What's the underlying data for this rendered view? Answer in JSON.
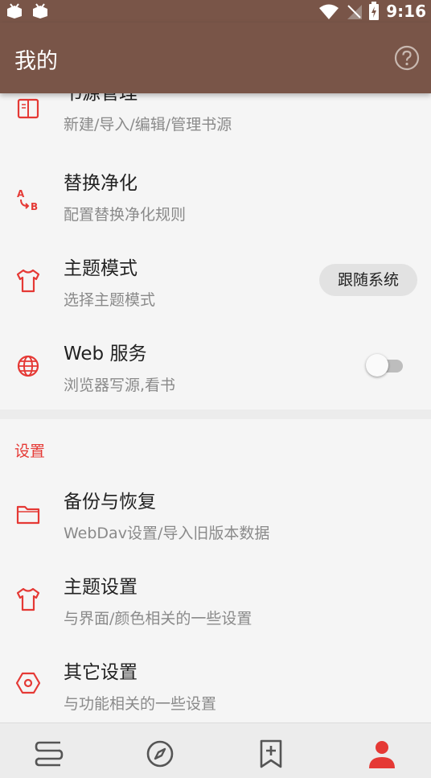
{
  "statusbar": {
    "time": "9:16"
  },
  "appbar": {
    "title": "我的"
  },
  "items_top": [
    {
      "title": "书源管理",
      "subtitle": "新建/导入/编辑/管理书源",
      "icon": "book-icon"
    },
    {
      "title": "替换净化",
      "subtitle": "配置替换净化规则",
      "icon": "replace-icon"
    },
    {
      "title": "主题模式",
      "subtitle": "选择主题模式",
      "icon": "shirt-icon",
      "value": "跟随系统"
    },
    {
      "title": "Web 服务",
      "subtitle": "浏览器写源,看书",
      "icon": "globe-icon",
      "toggle": false
    }
  ],
  "settings": {
    "section_title": "设置",
    "items": [
      {
        "title": "备份与恢复",
        "subtitle": "WebDav设置/导入旧版本数据",
        "icon": "folder-icon"
      },
      {
        "title": "主题设置",
        "subtitle": "与界面/颜色相关的一些设置",
        "icon": "shirt-icon"
      },
      {
        "title": "其它设置",
        "subtitle": "与功能相关的一些设置",
        "icon": "hexagon-settings-icon"
      }
    ]
  },
  "bottom_nav": [
    {
      "name": "bookshelf-icon",
      "active": false
    },
    {
      "name": "compass-icon",
      "active": false
    },
    {
      "name": "bookmark-add-icon",
      "active": false
    },
    {
      "name": "person-icon",
      "active": true
    }
  ],
  "colors": {
    "primary": "#795548",
    "accent": "#e53935",
    "icon_gray": "#555555"
  }
}
